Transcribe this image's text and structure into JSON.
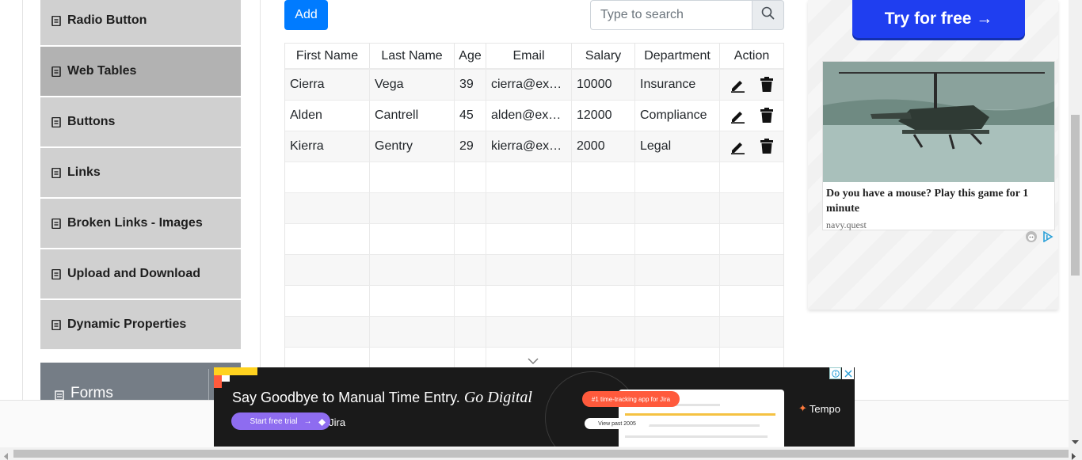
{
  "sidebar": {
    "items": [
      {
        "label": "Radio Button",
        "icon": "file-icon"
      },
      {
        "label": "Web Tables",
        "icon": "file-icon",
        "active": true
      },
      {
        "label": "Buttons",
        "icon": "file-icon"
      },
      {
        "label": "Links",
        "icon": "file-icon"
      },
      {
        "label": "Broken Links - Images",
        "icon": "file-icon"
      },
      {
        "label": "Upload and Download",
        "icon": "file-icon"
      },
      {
        "label": "Dynamic Properties",
        "icon": "file-icon"
      }
    ],
    "group": {
      "label": "Forms",
      "icon": "document-icon"
    }
  },
  "toolbar": {
    "add_label": "Add",
    "search_placeholder": "Type to search",
    "search_value": ""
  },
  "table": {
    "headers": [
      "First Name",
      "Last Name",
      "Age",
      "Email",
      "Salary",
      "Department",
      "Action"
    ],
    "rows": [
      {
        "first": "Cierra",
        "last": "Vega",
        "age": "39",
        "email": "cierra@example.com",
        "salary": "10000",
        "department": "Insurance"
      },
      {
        "first": "Alden",
        "last": "Cantrell",
        "age": "45",
        "email": "alden@example.com",
        "salary": "12000",
        "department": "Compliance"
      },
      {
        "first": "Kierra",
        "last": "Gentry",
        "age": "29",
        "email": "kierra@example.com",
        "salary": "2000",
        "department": "Legal"
      }
    ],
    "empty_rows": 7
  },
  "ad_right": {
    "cta_label": "Try for free →",
    "card_title": "Do you have a mouse? Play this game for 1 minute",
    "card_source": "navy.quest"
  },
  "ad_bottom": {
    "headline": "Say Goodbye to Manual Time Entry.",
    "headline_italic": "Go Digital",
    "cta_label": "Start free trial",
    "partner": "Jira",
    "badge": "#1 time-tracking app for Jira",
    "badge2": "View past 2005",
    "brand": "Tempo"
  },
  "colors": {
    "primary": "#007bff",
    "nav_bg": "#d0d0d0",
    "nav_active": "#b2b2b2",
    "ad_button": "#1f3ef0"
  }
}
